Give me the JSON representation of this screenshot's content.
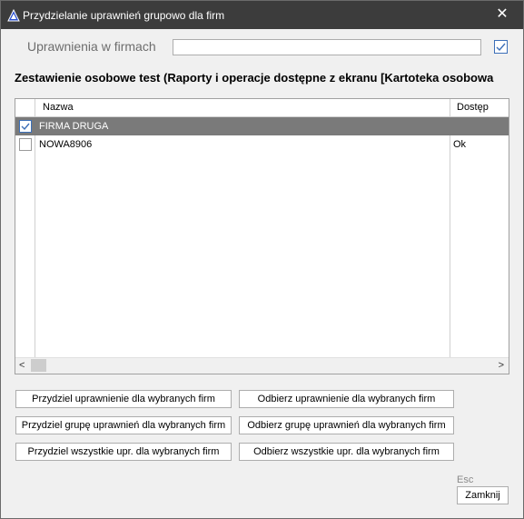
{
  "window": {
    "title": "Przydzielanie uprawnień grupowo dla firm",
    "close_glyph": "✕"
  },
  "filter": {
    "label": "Uprawnienia w firmach",
    "value": "",
    "checked": true
  },
  "heading": "Zestawienie osobowe test (Raporty i operacje dostępne z ekranu [Kartoteka osobowa",
  "grid": {
    "columns": [
      "Nazwa",
      "Dostęp"
    ],
    "rows": [
      {
        "name": "FIRMA DRUGA",
        "dostep": "",
        "checked": true,
        "selected": true
      },
      {
        "name": "NOWA8906",
        "dostep": "Ok",
        "checked": false,
        "selected": false
      }
    ],
    "scroll_left": "<",
    "scroll_right": ">"
  },
  "buttons": {
    "assign_selected": "Przydziel uprawnienie dla wybranych firm",
    "revoke_selected": "Odbierz uprawnienie dla wybranych firm",
    "assign_group": "Przydziel grupę uprawnień dla wybranych firm",
    "revoke_group": "Odbierz grupę uprawnień dla wybranych firm",
    "assign_all": "Przydziel wszystkie upr. dla wybranych firm",
    "revoke_all": "Odbierz wszystkie upr. dla wybranych firm",
    "close": "Zamknij",
    "close_hint": "Esc"
  },
  "colors": {
    "titlebar": "#3c3c3c",
    "selected_row": "#7a7a7a",
    "check_accent": "#3c6fb8"
  }
}
